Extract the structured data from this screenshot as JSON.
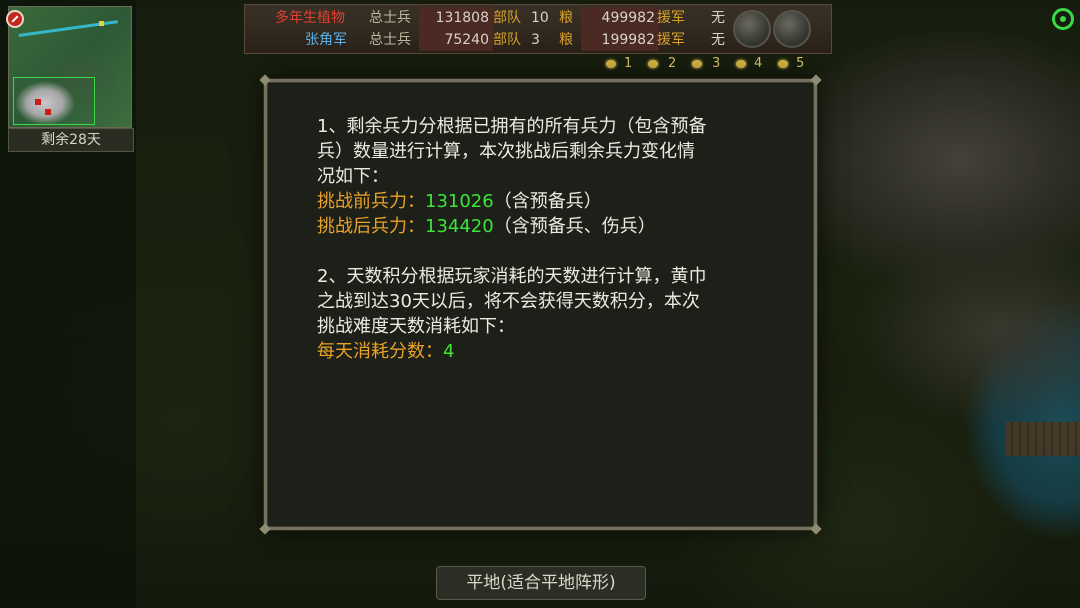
{
  "minimap": {
    "remaining_days": "剩余28天"
  },
  "topbar": {
    "player": {
      "name": "多年生植物",
      "troops_label": "总士兵",
      "troops": "131808",
      "units_label": "部队",
      "units": "10",
      "food_label": "粮",
      "food": "499982",
      "aid_label": "援军",
      "aid": "无"
    },
    "enemy": {
      "name": "张角军",
      "troops_label": "总士兵",
      "troops": "75240",
      "units_label": "部队",
      "units": "3",
      "food_label": "粮",
      "food": "199982",
      "aid_label": "援军",
      "aid": "无"
    }
  },
  "speed": [
    "1",
    "2",
    "3",
    "4",
    "5"
  ],
  "terrain": "平地(适合平地阵形)",
  "dialog": {
    "p1_line1": "1、剩余兵力分根据已拥有的所有兵力（包含预备",
    "p1_line2": "兵）数量进行计算，本次挑战后剩余兵力变化情",
    "p1_line3": "况如下：",
    "before_label": "挑战前兵力：",
    "before_value": "131026",
    "before_note": "（含预备兵）",
    "after_label": "挑战后兵力：",
    "after_value": "134420",
    "after_note": "（含预备兵、伤兵）",
    "p2_line1": "2、天数积分根据玩家消耗的天数进行计算，黄巾",
    "p2_line2": "之战到达30天以后，将不会获得天数积分，本次",
    "p2_line3": "挑战难度天数消耗如下：",
    "daily_label": "每天消耗分数：",
    "daily_value": "4"
  },
  "colors": {
    "highlight_orange": "#e9a328",
    "highlight_green": "#3ee43a",
    "text": "#ecebe2"
  }
}
